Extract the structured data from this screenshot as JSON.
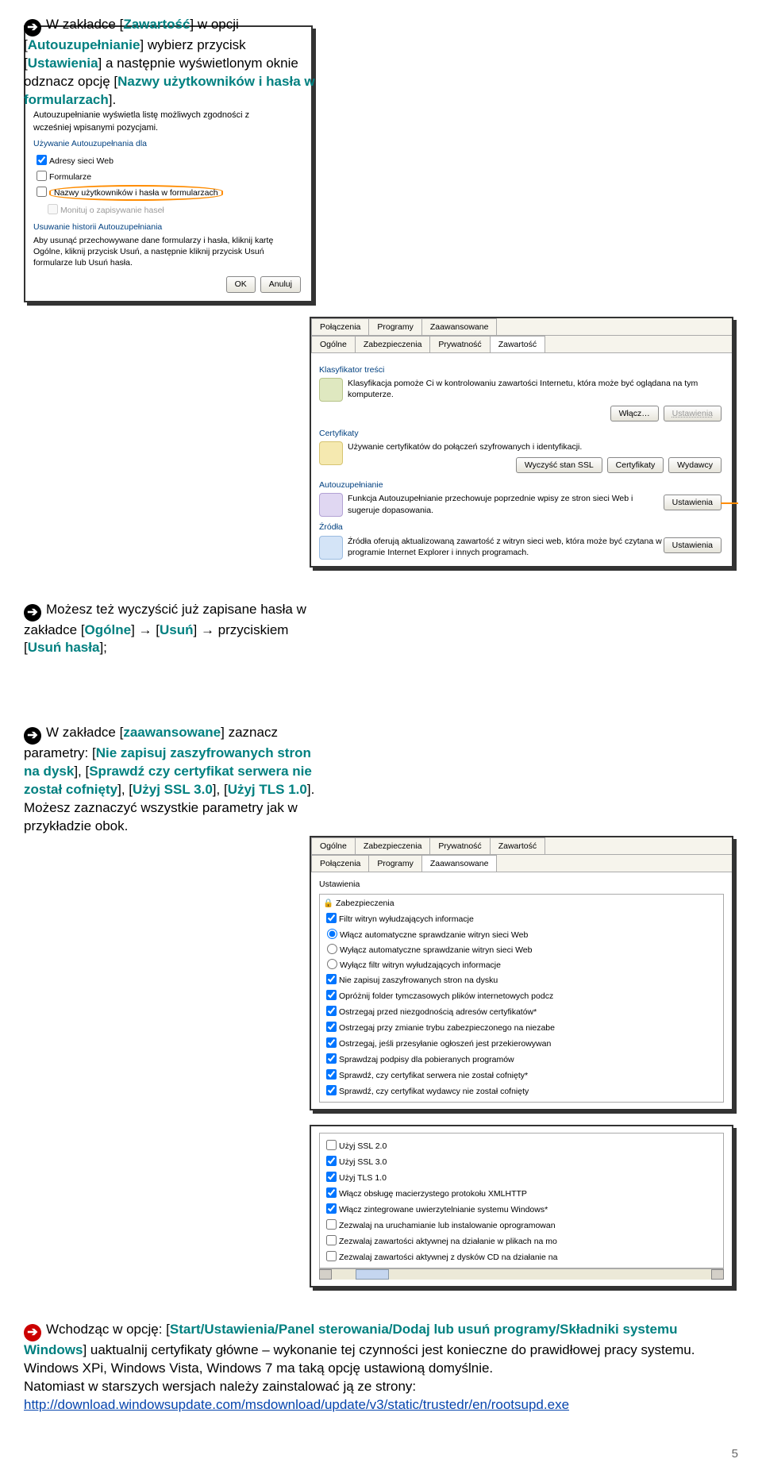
{
  "section1": {
    "text_a": "W zakładce [",
    "tab": "Zawartość",
    "text_b": "] w opcji [",
    "opt": "Autouzupełnianie",
    "text_c": "] wybierz przycisk [",
    "btn": "Ustawienia",
    "text_d": "] a następnie wyświetlonym oknie odznacz opcję [",
    "opt2": "Nazwy użytkowników i hasła w formularzach",
    "text_e": "]."
  },
  "mock_autouzup": {
    "title_line1": "Autouzupełnianie wyświetla listę możliwych zgodności z",
    "title_line2": "wcześniej wpisanymi pozycjami.",
    "group1": "Używanie Autouzupełnania dla",
    "chk1": "Adresy sieci Web",
    "chk2": "Formularze",
    "chk3": "Nazwy użytkowników i hasła w formularzach",
    "chk4": "Monituj o zapisywanie haseł",
    "group2": "Usuwanie historii Autouzupełniania",
    "desc": "Aby usunąć przechowywane dane formularzy i hasła, kliknij kartę Ogólne, kliknij przycisk Usuń, a następnie kliknij przycisk Usuń formularze lub Usuń hasła.",
    "ok": "OK",
    "cancel": "Anuluj"
  },
  "mock_opcje": {
    "tab1": "Połączenia",
    "tab2": "Programy",
    "tab3": "Zaawansowane",
    "tab4": "Ogólne",
    "tab5": "Zabezpieczenia",
    "tab6": "Prywatność",
    "tab7": "Zawartość",
    "g1": "Klasyfikator treści",
    "g1_desc": "Klasyfikacja pomoże Ci w kontrolowaniu zawartości Internetu, która może być oglądana na tym komputerze.",
    "b_wlacz": "Włącz…",
    "b_ust": "Ustawienia",
    "g2": "Certyfikaty",
    "g2_desc": "Używanie certyfikatów do połączeń szyfrowanych i identyfikacji.",
    "b_wyczysc": "Wyczyść stan SSL",
    "b_cert": "Certyfikaty",
    "b_wyd": "Wydawcy",
    "g3": "Autouzupełnianie",
    "g3_desc": "Funkcja Autouzupełnianie przechowuje poprzednie wpisy ze stron sieci Web i sugeruje dopasowania.",
    "g4": "Źródła",
    "g4_desc": "Źródła oferują aktualizowaną zawartość z witryn sieci web, która może być czytana w programie Internet Explorer i innych programach."
  },
  "section2": {
    "text_a": "Możesz też wyczyścić już zapisane hasła w zakładce [",
    "tab": "Ogólne",
    "text_b": "] → [",
    "btn1": "Usuń",
    "text_c": "] → przyciskiem [",
    "btn2": "Usuń hasła",
    "text_d": "];"
  },
  "section3": {
    "text_a": "W zakładce [",
    "tab": "zaawansowane",
    "text_b": "] zaznacz parametry: [",
    "p1": "Nie zapisuj zaszyfrowanych stron na dysk",
    "text_c": "], [",
    "p2": "Sprawdź czy certyfikat serwera nie został cofnięty",
    "text_d": "], [",
    "p3": "Użyj SSL 3.0",
    "text_e": "], [",
    "p4": "Użyj TLS 1.0",
    "text_f": "]. Możesz zaznaczyć wszystkie parametry jak w przykładzie obok."
  },
  "mock_zab": {
    "tab1": "Ogólne",
    "tab2": "Zabezpieczenia",
    "tab3": "Prywatność",
    "tab4": "Zawartość",
    "tab5": "Połączenia",
    "tab6": "Programy",
    "tab7": "Zaawansowane",
    "g": "Ustawienia",
    "cat": "Zabezpieczenia",
    "i1": "Filtr witryn wyłudzających informacje",
    "i2": "Włącz automatyczne sprawdzanie witryn sieci Web",
    "i3": "Wyłącz automatyczne sprawdzanie witryn sieci Web",
    "i4": "Wyłącz filtr witryn wyłudzających informacje",
    "i5": "Nie zapisuj zaszyfrowanych stron na dysku",
    "i6": "Opróżnij folder tymczasowych plików internetowych podcz",
    "i7": "Ostrzegaj przed niezgodnością adresów certyfikatów*",
    "i8": "Ostrzegaj przy zmianie trybu zabezpieczonego na niezabe",
    "i9": "Ostrzegaj, jeśli przesyłanie ogłoszeń jest przekierowywan",
    "i10": "Sprawdzaj podpisy dla pobieranych programów",
    "i11": "Sprawdź, czy certyfikat serwera nie został cofnięty*",
    "i12": "Sprawdź, czy certyfikat wydawcy nie został cofnięty"
  },
  "mock_ssl": {
    "i1": "Użyj SSL 2.0",
    "i2": "Użyj SSL 3.0",
    "i3": "Użyj TLS 1.0",
    "i4": "Włącz obsługę macierzystego protokołu XMLHTTP",
    "i5": "Włącz zintegrowane uwierzytelnianie systemu Windows*",
    "i6": "Zezwalaj na uruchamianie lub instalowanie oprogramowan",
    "i7": "Zezwalaj zawartości aktywnej na działanie w plikach na mo",
    "i8": "Zezwalaj zawartości aktywnej z dysków CD na działanie na"
  },
  "section4": {
    "text_a": "Wchodząc w opcję: [",
    "path": "Start/Ustawienia/Panel sterowania/Dodaj lub usuń programy/Składniki systemu Windows",
    "text_b": "] uaktualnij certyfikaty główne – wykonanie tej czynności jest konieczne do prawidłowej pracy systemu.",
    "line2": "Windows XPi, Windows Vista, Windows 7 ma taką opcję ustawioną domyślnie.",
    "line3": "Natomiast w starszych wersjach należy zainstalować ją ze strony:",
    "url": "http://download.windowsupdate.com/msdownload/update/v3/static/trustedr/en/rootsupd.exe"
  },
  "page": "5"
}
